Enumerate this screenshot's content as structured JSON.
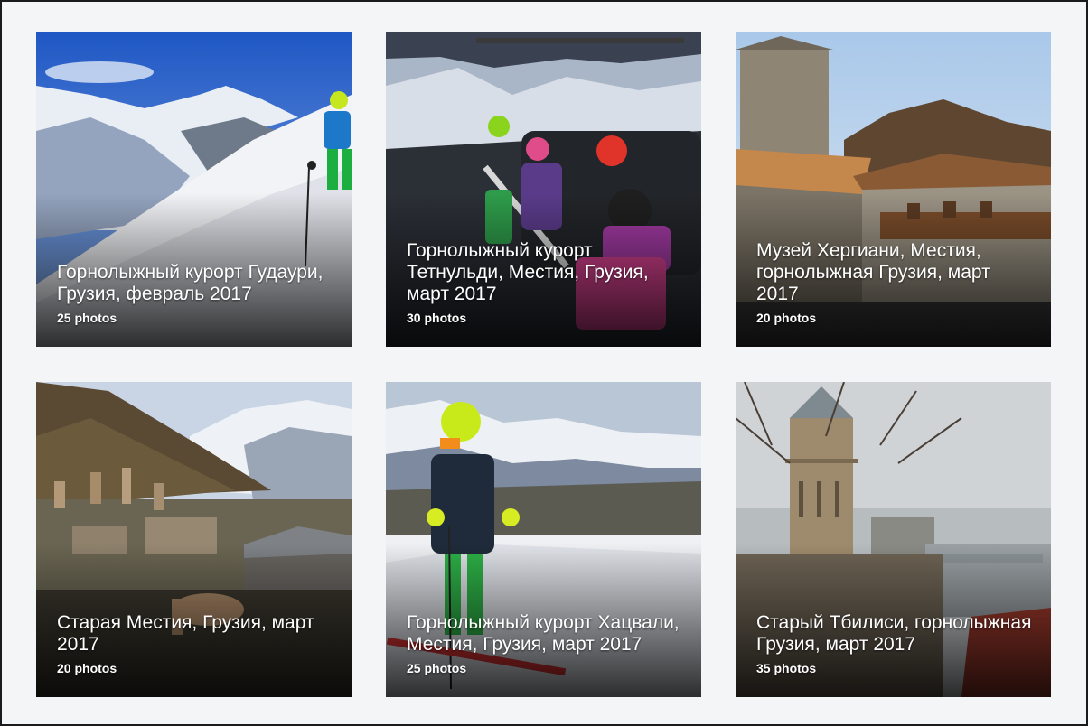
{
  "albums": [
    {
      "title": "Горнолыжный курорт Гудаури, Грузия, февраль 2017",
      "count": "25 photos"
    },
    {
      "title": "Горнолыжный курорт Тетнульди, Местия, Грузия, март 2017",
      "count": "30 photos"
    },
    {
      "title": "Музей Хергиани, Местия, горнолыжная Грузия, март 2017",
      "count": "20 photos"
    },
    {
      "title": "Старая Местия, Грузия, март 2017",
      "count": "20 photos"
    },
    {
      "title": "Горнолыжный курорт Хацвали, Местия, Грузия, март 2017",
      "count": "25 photos"
    },
    {
      "title": "Старый Тбилиси, горнолыжная Грузия, март 2017",
      "count": "35 photos"
    }
  ]
}
